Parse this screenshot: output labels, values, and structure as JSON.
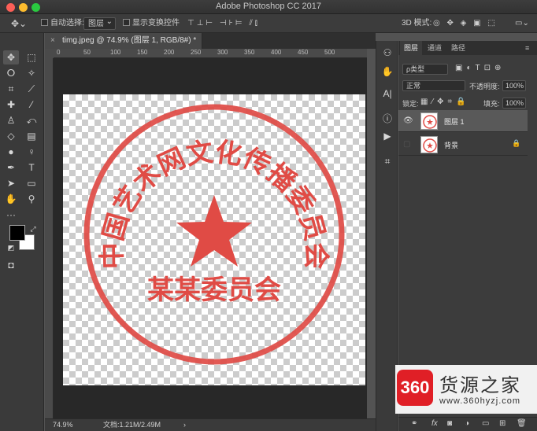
{
  "app": {
    "title": "Adobe Photoshop CC 2017"
  },
  "options_bar": {
    "auto_select_label": "自动选择:",
    "auto_select_value": "图层",
    "show_transform_label": "显示变换控件",
    "mode_3d_label": "3D 模式:"
  },
  "document": {
    "tab_label": "timg.jpeg @ 74.9% (图层 1, RGB/8#) *",
    "close_glyph": "×"
  },
  "ruler": {
    "ticks": [
      "0",
      "50",
      "100",
      "150",
      "200",
      "250",
      "300",
      "350",
      "400",
      "450",
      "500"
    ]
  },
  "stamp": {
    "ring_text": "中国艺术网文化传播委员会",
    "bottom_text": "某某委员会",
    "color": "#e04b45"
  },
  "status": {
    "zoom": "74.9%",
    "doc_size": "文档:1.21M/2.49M"
  },
  "layers_panel": {
    "tabs": [
      "图层",
      "通道",
      "路径"
    ],
    "filter_label": "ρ类型",
    "blend_mode": "正常",
    "opacity_label": "不透明度:",
    "opacity_value": "100%",
    "lock_label": "锁定:",
    "fill_label": "填充:",
    "fill_value": "100%",
    "layers": [
      {
        "name": "图层 1",
        "visible": true,
        "selected": true
      },
      {
        "name": "背景",
        "visible": false,
        "selected": false,
        "locked": true
      }
    ]
  },
  "watermark": {
    "logo_text": "360",
    "title": "货源之家",
    "url": "www.360hyzj.com"
  },
  "colors": {
    "foreground": "#000000",
    "background": "#ffffff",
    "stamp_red": "#e04b45"
  }
}
